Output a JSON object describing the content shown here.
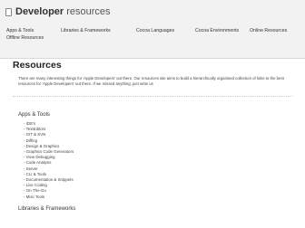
{
  "header": {
    "brand_strong": "Developer",
    "brand_light": "resources"
  },
  "nav": [
    "Apps & Tools",
    "Libraries & Frameworks",
    "Cocoa Languages",
    "Cocoa Environments",
    "Online Resources",
    "Offline Resources"
  ],
  "main": {
    "title": "Resources",
    "intro": "There are many interesting things for 'Apple Developers' out there. Our resources site aims to build a hierarchically organised collection of links to the best resources for 'Apple Developers' out there. If we missed anything, just write us",
    "sections": [
      {
        "title": "Apps & Tools",
        "items": [
          "- IDE's",
          "- TextEditors",
          "- GIT & SVN",
          "- Diffing",
          "- Design & Graphics",
          "- Graphics Code Generators",
          "- View Debugging",
          "- Code Analysis",
          "- Server",
          "- CLI & Tools",
          "- Documentation & Snippets",
          "- Live Coding",
          "- On-The-Go",
          "- Misc Tools"
        ]
      },
      {
        "title": "Libraries & Frameworks"
      }
    ]
  }
}
